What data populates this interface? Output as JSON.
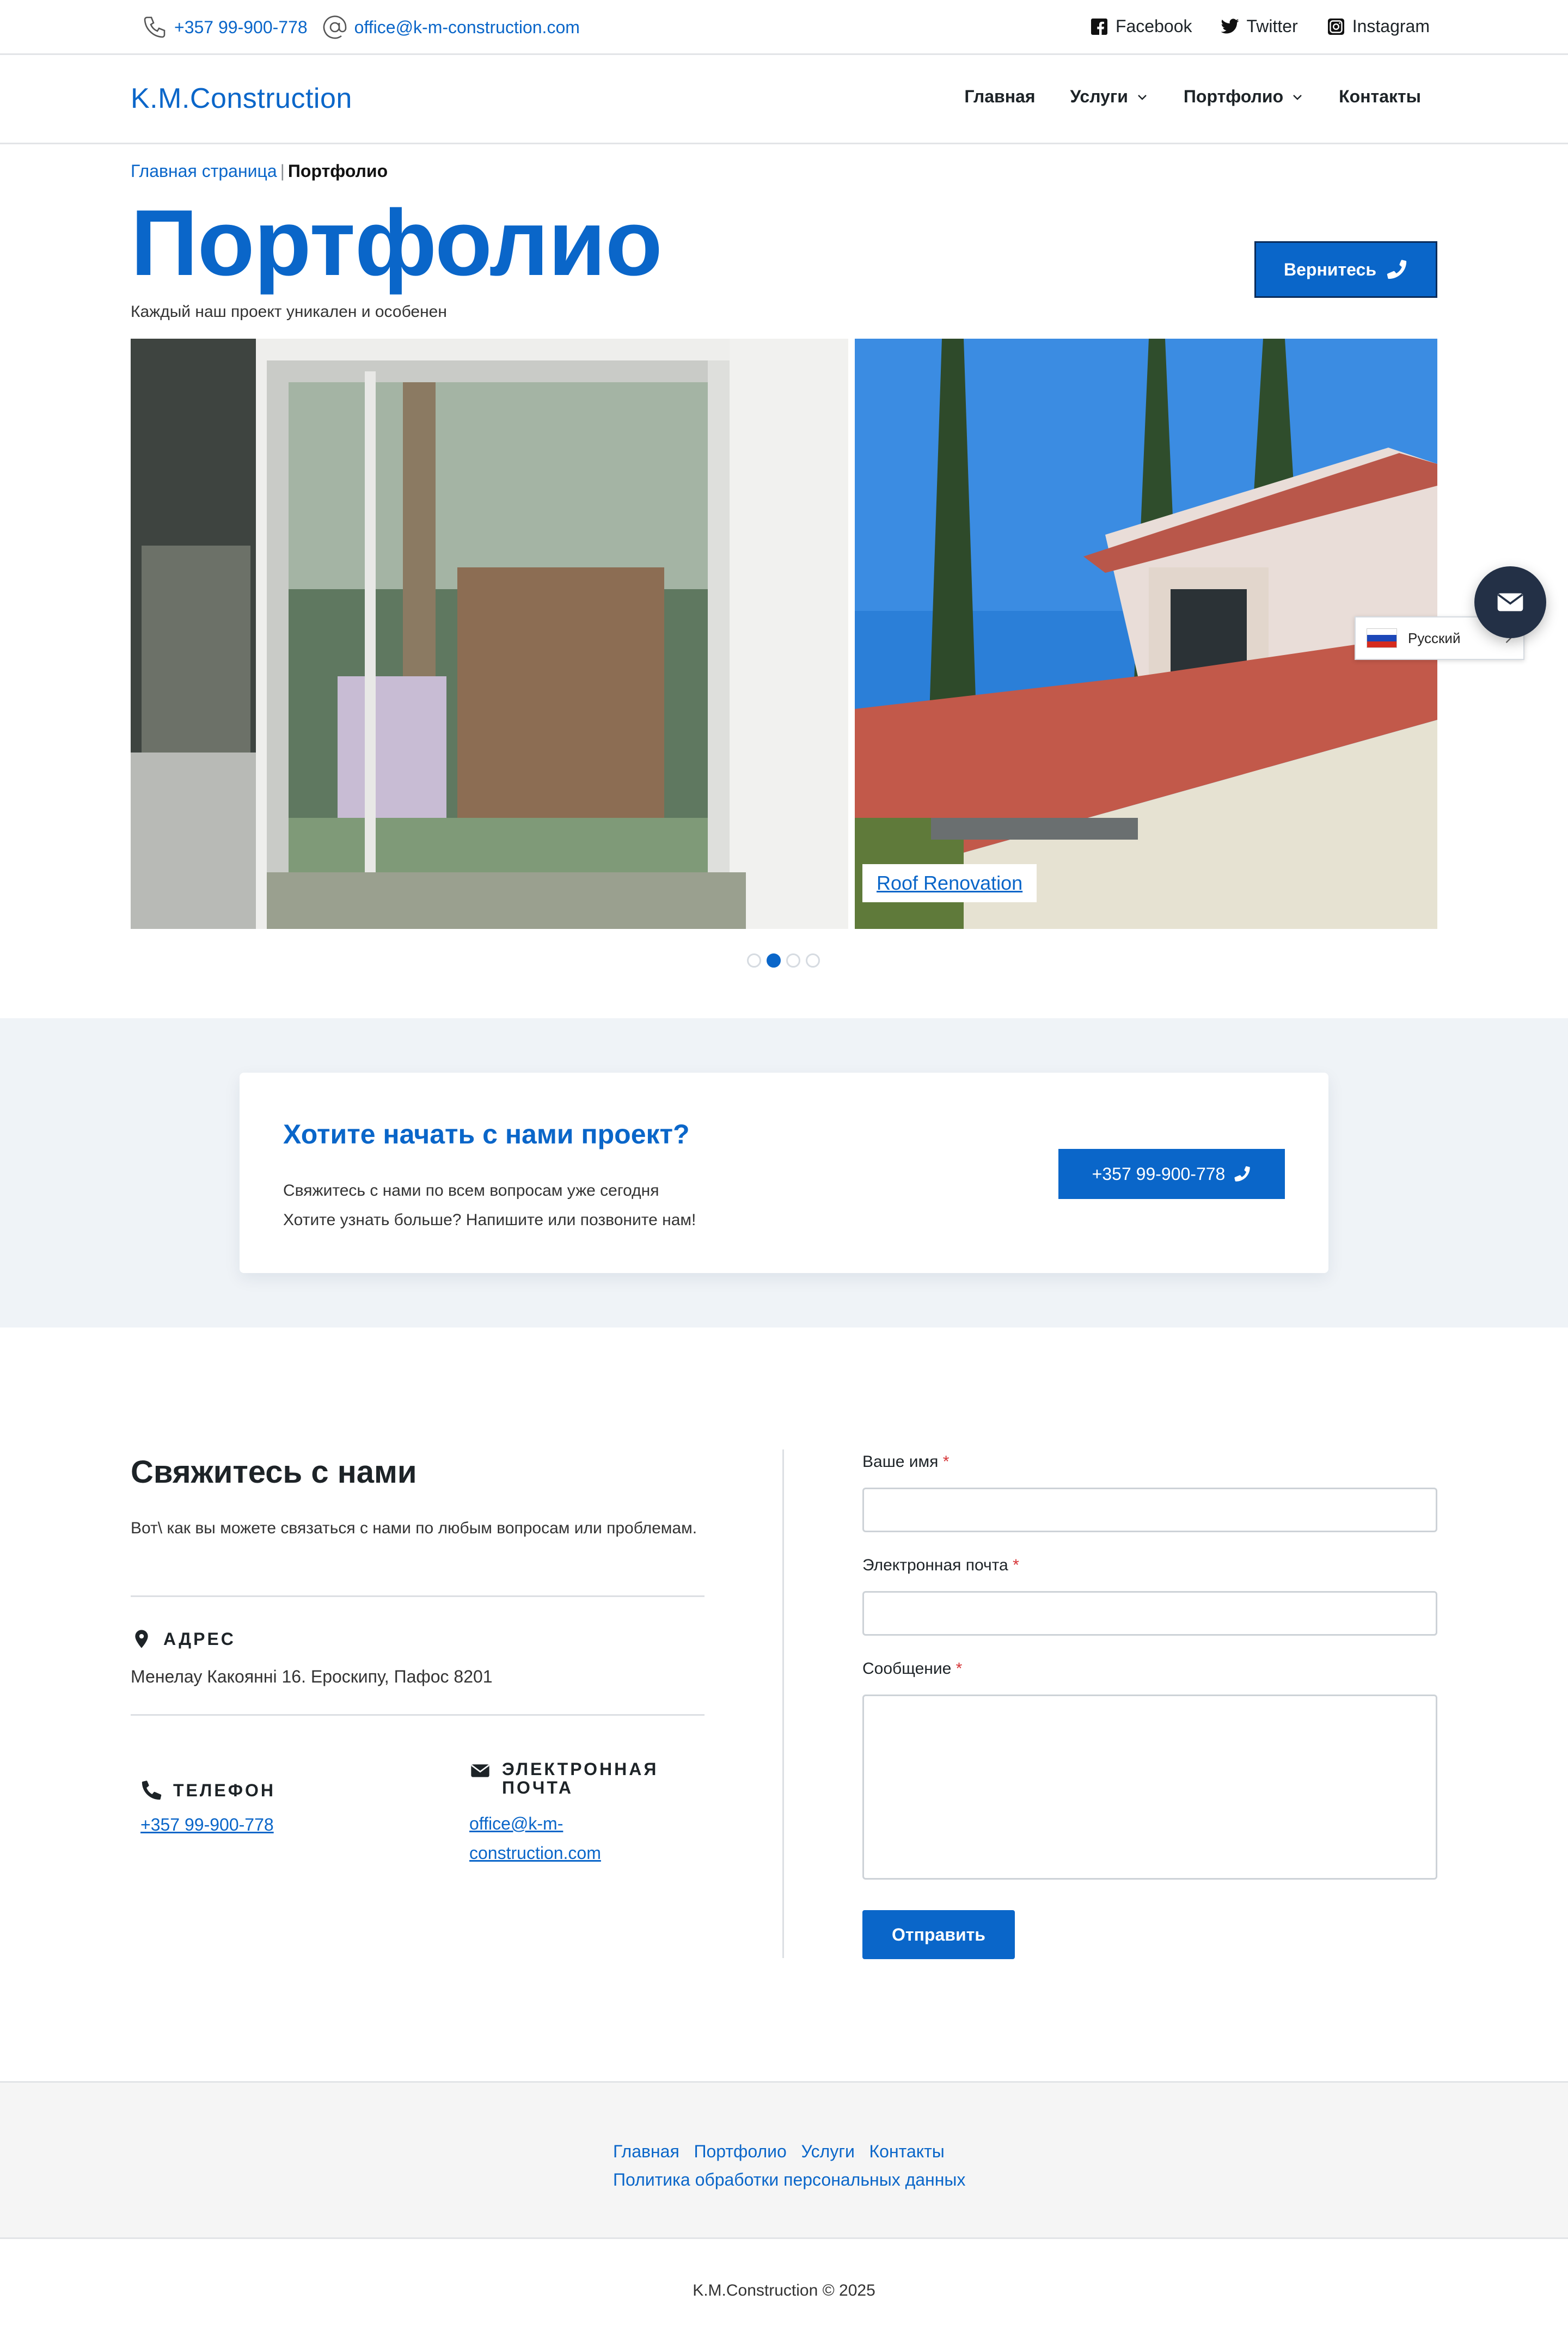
{
  "topbar": {
    "phone": "+357 99-900-778",
    "email": "office@k-m-construction.com",
    "socials": [
      "Facebook",
      "Twitter",
      "Instagram"
    ]
  },
  "header": {
    "logo": "K.M.Construction",
    "nav": [
      "Главная",
      "Услуги",
      "Портфолио",
      "Контакты"
    ]
  },
  "breadcrumb": {
    "home": "Главная страница",
    "separator": "|",
    "current": "Портфолио"
  },
  "hero": {
    "title": "Портфолио",
    "subtitle": "Каждый наш проект уникален и особенен",
    "back_button": "Вернитесь"
  },
  "slider": {
    "caption": "Roof Renovation",
    "dots_total": 4,
    "active_dot": 2
  },
  "language": {
    "label": "Русский"
  },
  "cta": {
    "title": "Хотите начать с нами проект?",
    "line1": "Свяжитесь с нами по всем вопросам уже сегодня",
    "line2": "Хотите узнать больше? Напишите или позвоните нам!",
    "button": "+357 99-900-778"
  },
  "contact": {
    "title": "Свяжитесь с нами",
    "description": "Вот\\ как вы можете связаться с нами по любым вопросам или проблемам.",
    "address_label": "АДРЕС",
    "address_value": "Менелау Какояннi 16. Ероскипу, Пафос 8201",
    "phone_label": "ТЕЛЕФОН",
    "phone_value": "+357 99-900-778",
    "email_label_1": "ЭЛЕКТРОННАЯ",
    "email_label_2": "ПОЧТА",
    "email_value_1": "office@k-m-",
    "email_value_2": "construction.com"
  },
  "form": {
    "name_label": "Ваше имя",
    "email_label": "Электронная почта",
    "message_label": "Сообщение",
    "required_mark": "*",
    "submit": "Отправить"
  },
  "footer": {
    "links": [
      "Главная",
      "Портфолио",
      "Услуги",
      "Контакты"
    ],
    "policy": "Политика обработки персональных данных",
    "copyright": "K.M.Construction © 2025"
  },
  "colors": {
    "accent": "#0a66c9",
    "dark": "#1d2327",
    "band": "#eff3f7"
  }
}
